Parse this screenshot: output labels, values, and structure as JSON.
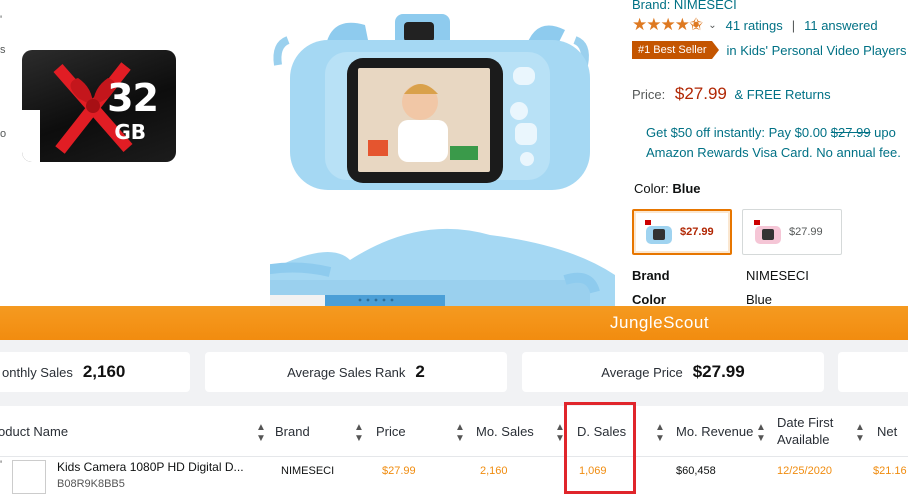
{
  "product": {
    "brand_link": "Brand: NIMESECI",
    "stars_display": "★★★★✬",
    "ratings": "41 ratings",
    "answered": "11 answered",
    "best_seller_badge": "#1 Best Seller",
    "category_link": "in Kids' Personal Video Players",
    "price_label": "Price:",
    "price": "$27.99",
    "returns": "& FREE Returns",
    "promo_line1": "Get $50 off instantly: Pay $0.00",
    "promo_strike": "$27.99",
    "promo_tail": "upo",
    "promo_line2": "Amazon Rewards Visa Card. No annual fee.",
    "color_label": "Color:",
    "color_value": "Blue",
    "swatches": [
      {
        "price": "$27.99",
        "color": "#9fd3f0"
      },
      {
        "price": "$27.99",
        "color": "#f5c6d6"
      }
    ],
    "specs": [
      {
        "key": "Brand",
        "value": "NIMESECI"
      },
      {
        "key": "Color",
        "value": "Blue"
      }
    ],
    "sd_card": {
      "capacity": "32",
      "unit": "GB"
    }
  },
  "junglescout": {
    "title": "JungleScout",
    "stats": [
      {
        "label": "onthly Sales",
        "value": "2,160"
      },
      {
        "label": "Average Sales Rank",
        "value": "2"
      },
      {
        "label": "Average Price",
        "value": "$27.99"
      }
    ],
    "columns": [
      "oduct Name",
      "Brand",
      "Price",
      "Mo. Sales",
      "D. Sales",
      "Mo. Revenue",
      "Date First Available",
      "Net"
    ],
    "row": {
      "name": "Kids Camera 1080P HD Digital D...",
      "asin": "B08R9K8BB5",
      "brand": "NIMESECI",
      "price": "$27.99",
      "mo_sales": "2,160",
      "d_sales": "1,069",
      "mo_revenue": "$60,458",
      "date_first": "12/25/2020",
      "net": "$21.16"
    }
  },
  "colors": {
    "orange": "#f28c0f",
    "amazon_link": "#007185",
    "price_red": "#b12704",
    "highlight": "#e0252b"
  }
}
